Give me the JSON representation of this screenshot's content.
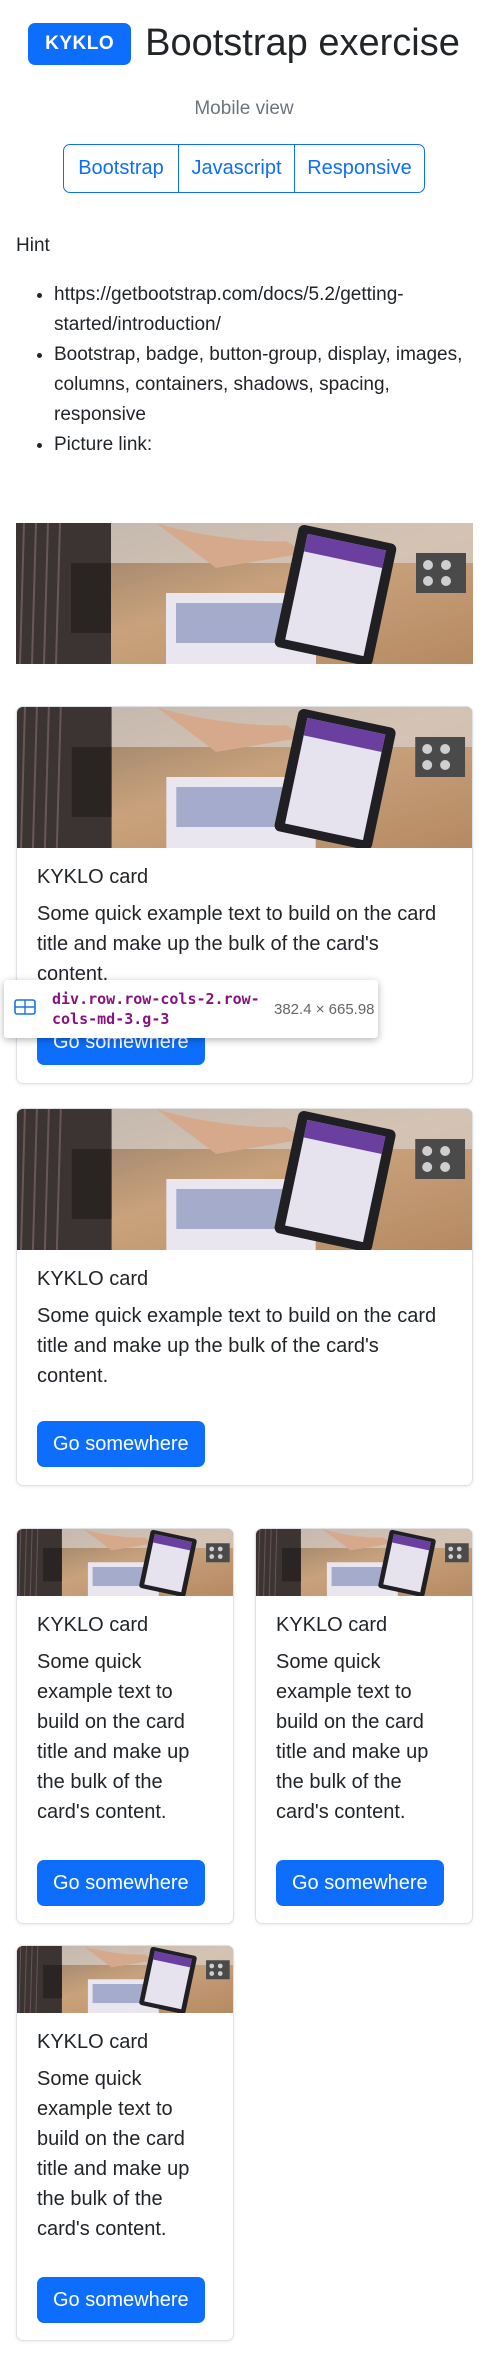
{
  "header": {
    "badge": "KYKLO",
    "title": "Bootstrap exercise",
    "subtitle": "Mobile view"
  },
  "button_group": [
    {
      "label": "Bootstrap"
    },
    {
      "label": "Javascript"
    },
    {
      "label": "Responsive"
    }
  ],
  "hint": {
    "label": "Hint",
    "items": [
      "https://getbootstrap.com/docs/5.2/getting-started/introduction/",
      "Bootstrap, badge, button-group, display, images, columns, containers, shadows, spacing, responsive",
      "Picture link:"
    ]
  },
  "cards": [
    {
      "title": "KYKLO card",
      "text": "Some quick example text to build on the card title and make up the bulk of the card's content.",
      "button": "Go somewhere"
    },
    {
      "title": "KYKLO card",
      "text": "Some quick example text to build on the card title and make up the bulk of the card's content.",
      "button": "Go somewhere"
    },
    {
      "title": "KYKLO card",
      "text": "Some quick example text to build on the card title and make up the bulk of the card's content.",
      "button": "Go somewhere"
    },
    {
      "title": "KYKLO card",
      "text": "Some quick example text to build on the card title and make up the bulk of the card's content.",
      "button": "Go somewhere"
    },
    {
      "title": "KYKLO card",
      "text": "Some quick example text to build on the card title and make up the bulk of the card's content.",
      "button": "Go somewhere"
    }
  ],
  "inspector_tooltip": {
    "selector": "div.row.row-cols-2.row-cols-md-3.g-3",
    "size": "382.4 × 665.98"
  },
  "colors": {
    "primary": "#0d6efd",
    "muted": "#6c757d",
    "selector": "#881280"
  }
}
